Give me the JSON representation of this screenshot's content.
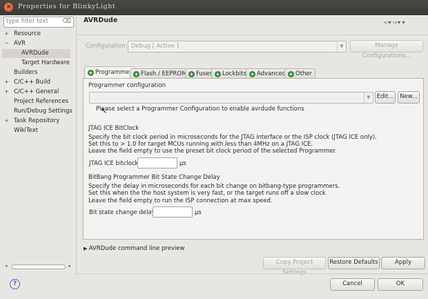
{
  "window": {
    "title": "Properties for BlinkyLight"
  },
  "sidebar": {
    "filter_placeholder": "type filter text",
    "items": [
      {
        "label": "Resource",
        "toggle": "+"
      },
      {
        "label": "AVR",
        "toggle": "−"
      },
      {
        "label": "AVRDude",
        "toggle": ""
      },
      {
        "label": "Target Hardware",
        "toggle": ""
      },
      {
        "label": "Builders",
        "toggle": ""
      },
      {
        "label": "C/C++ Build",
        "toggle": "+"
      },
      {
        "label": "C/C++ General",
        "toggle": "+"
      },
      {
        "label": "Project References",
        "toggle": ""
      },
      {
        "label": "Run/Debug Settings",
        "toggle": ""
      },
      {
        "label": "Task Repository",
        "toggle": "+"
      },
      {
        "label": "WikiText",
        "toggle": ""
      }
    ]
  },
  "header": {
    "title": "AVRDude",
    "nav_icons": "⇦▾ ⇨▾ ▾"
  },
  "configuration": {
    "label": "Configuration:",
    "value": "Debug  [ Active ]",
    "manage_label": "Manage Configurations..."
  },
  "tabs": [
    {
      "label": "Programmer"
    },
    {
      "label": "Flash / EEPROM"
    },
    {
      "label": "Fuses"
    },
    {
      "label": "Lockbits"
    },
    {
      "label": "Advanced"
    },
    {
      "label": "Other"
    }
  ],
  "programmer": {
    "section_title": "Programmer configuration",
    "edit_label": "Edit...",
    "new_label": "New...",
    "warning": "Please select a Programmer Configuration to enable avrdude functions"
  },
  "jtag": {
    "title": "JTAG ICE BitClock",
    "lines": [
      "Specify the bit clock period in microseconds for the JTAG interface or the ISP clock (JTAG ICE only).",
      "Set this to > 1.0 for target MCUs running with less than 4MHz on a JTAG ICE.",
      "Leave the field empty to use the preset bit clock period of the selected Programmer."
    ],
    "field_label": "JTAG ICE bitclock",
    "unit": "µs"
  },
  "bitbang": {
    "title": "BitBang Programmer Bit State Change Delay",
    "lines": [
      "Specify the delay in microseconds for each bit change on bitbang-type programmers.",
      "Set this when the the host system is very fast, or the target runs off a slow clock",
      "Leave the field empty to run the ISP connection at max speed."
    ],
    "field_label": "Bit state change delay",
    "unit": "µs"
  },
  "preview": {
    "label": "AVRDude command line preview"
  },
  "buttons": {
    "copy": "Copy Project Settings",
    "restore": "Restore Defaults",
    "apply": "Apply",
    "cancel": "Cancel",
    "ok": "OK"
  }
}
